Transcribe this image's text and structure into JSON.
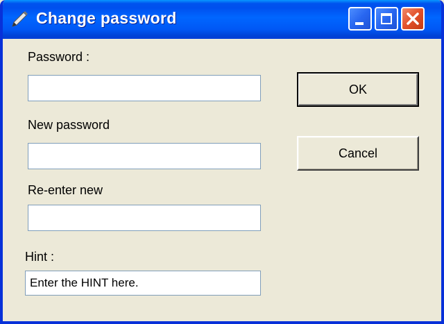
{
  "window": {
    "title": "Change password",
    "title_icon": "pencil-icon",
    "controls": [
      "minimize-icon",
      "maximize-icon",
      "close-icon"
    ]
  },
  "form": {
    "password_label": "Password :",
    "password_value": "",
    "new_password_label": "New password",
    "new_password_value": "",
    "reenter_label": "Re-enter new",
    "reenter_value": "",
    "hint_label": "Hint :",
    "hint_value": "Enter the HINT here."
  },
  "buttons": {
    "ok_label": "OK",
    "cancel_label": "Cancel"
  },
  "colors": {
    "titlebar": "#0058f5",
    "window_bg": "#ece9d8",
    "close_button": "#e2502a"
  }
}
